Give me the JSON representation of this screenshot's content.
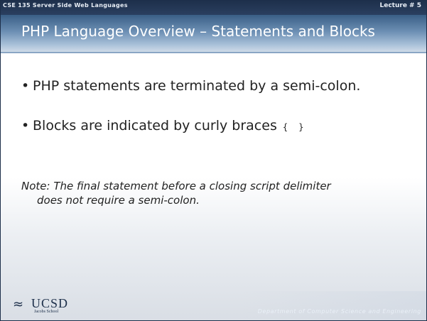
{
  "header": {
    "course": "CSE 135   Server Side Web Languages",
    "lecture": "Lecture # 5"
  },
  "title": "PHP Language Overview – Statements and Blocks",
  "bullets": [
    {
      "marker": "•",
      "text": "PHP statements are terminated by a semi-colon."
    },
    {
      "marker": "•",
      "text": "Blocks are indicated by curly braces",
      "code": "{ }"
    }
  ],
  "note": {
    "line1": "Note: The final statement before a closing script delimiter",
    "line2": "does not require a semi-colon."
  },
  "footer": {
    "logo_text": "UCSD",
    "logo_sub": "Jacobs School",
    "department": "Department of Computer Science and Engineering"
  }
}
